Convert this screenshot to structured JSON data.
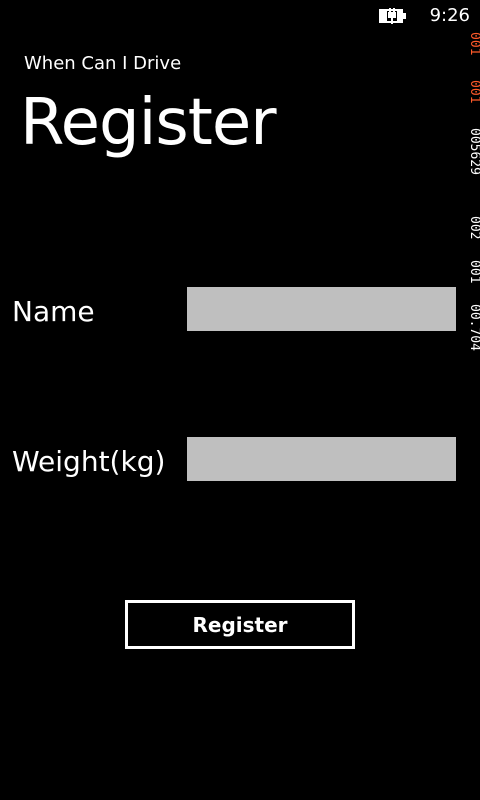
{
  "status_bar": {
    "time": "9:26",
    "battery_icon": "battery-charging-icon"
  },
  "header": {
    "app_title": "When Can I Drive",
    "page_title": "Register"
  },
  "form": {
    "name": {
      "label": "Name",
      "value": ""
    },
    "weight": {
      "label": "Weight(kg)",
      "value": ""
    },
    "submit_label": "Register"
  },
  "frame_rate_counters": [
    {
      "value": "001",
      "color": "#ff5a2a"
    },
    {
      "value": "001",
      "color": "#ff5a2a"
    },
    {
      "value": "005629",
      "color": "#ffffff"
    },
    {
      "value": "002",
      "color": "#ffffff"
    },
    {
      "value": "001",
      "color": "#ffffff"
    },
    {
      "value": "00.704",
      "color": "#ffffff"
    }
  ],
  "colors": {
    "background": "#000000",
    "foreground": "#ffffff",
    "textbox": "#bfbfbf",
    "counter_highlight": "#ff5a2a"
  }
}
